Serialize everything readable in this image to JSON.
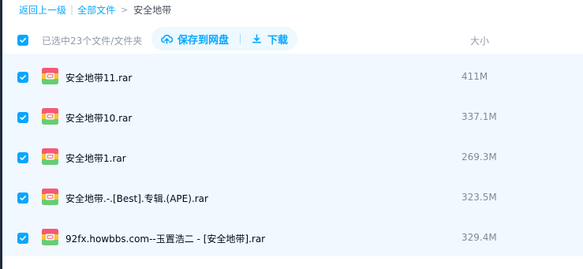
{
  "breadcrumb": {
    "back": "返回上一级",
    "all_files": "全部文件",
    "separator": "|",
    "arrow": ">",
    "current": "安全地带"
  },
  "toolbar": {
    "selected_count": "已选中23个文件/文件夹",
    "save_label": "保存到网盘",
    "download_label": "下载",
    "size_header": "大小"
  },
  "colors": {
    "accent": "#06a7ff",
    "list_background": "#f2f8ff",
    "action_pill_background": "#eef8ff"
  },
  "icons": {
    "select_all": "checkmark-icon",
    "save": "cloud-upload-icon",
    "download": "download-icon",
    "file": "archive-file-icon"
  },
  "files": [
    {
      "name": "安全地带11.rar",
      "size": "411M",
      "selected": true
    },
    {
      "name": "安全地带10.rar",
      "size": "337.1M",
      "selected": true
    },
    {
      "name": "安全地带1.rar",
      "size": "269.3M",
      "selected": true
    },
    {
      "name": "安全地带.-.[Best].专辑.(APE).rar",
      "size": "323.5M",
      "selected": true
    },
    {
      "name": "92fx.howbbs.com--玉置浩二 - [安全地带].rar",
      "size": "329.4M",
      "selected": true
    }
  ]
}
